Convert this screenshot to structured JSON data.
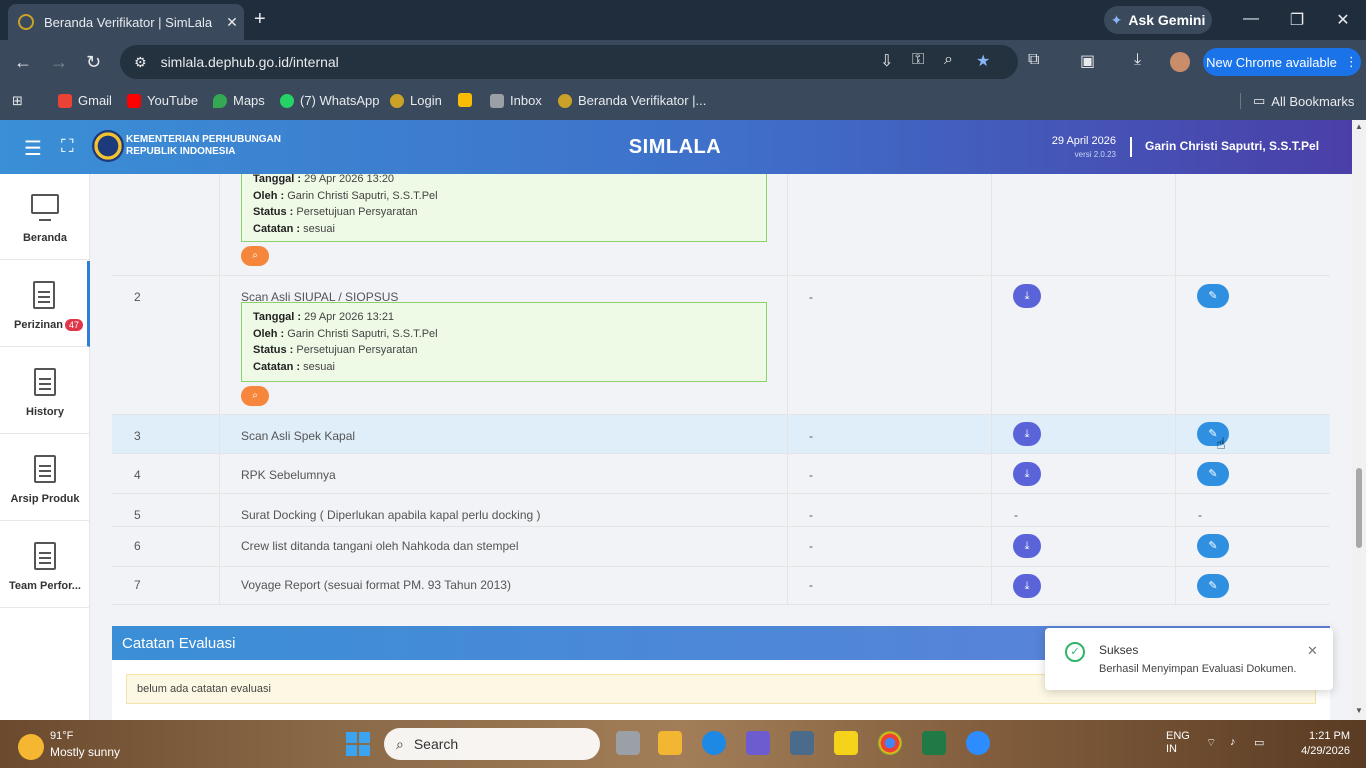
{
  "browser": {
    "tab_title": "Beranda Verifikator | SimLala",
    "new_tab": "+",
    "gemini": "Ask Gemini",
    "url": "simlala.dephub.go.id/internal",
    "new_chrome": "New Chrome available",
    "bookmarks": [
      {
        "label": "Gmail",
        "color": "#ea4335"
      },
      {
        "label": "YouTube",
        "color": "#ff0000"
      },
      {
        "label": "Maps",
        "color": "#34a853"
      },
      {
        "label": "(7) WhatsApp",
        "color": "#25d366"
      },
      {
        "label": "Login",
        "color": "#c9a227"
      },
      {
        "label": "",
        "color": "#fbbc05"
      },
      {
        "label": "Inbox",
        "color": "#9aa0a6"
      },
      {
        "label": "Beranda Verifikator |...",
        "color": "#c9a227"
      }
    ],
    "all_bookmarks": "All Bookmarks"
  },
  "header": {
    "ministry_line1": "KEMENTERIAN PERHUBUNGAN",
    "ministry_line2": "REPUBLIK INDONESIA",
    "app_name": "SIMLALA",
    "date": "29 April 2026",
    "version": "versi 2.0.23",
    "user": "Garin Christi Saputri, S.S.T.Pel"
  },
  "sidebar": {
    "items": [
      {
        "label": "Beranda",
        "icon": "monitor-icon"
      },
      {
        "label": "Perizinan",
        "icon": "document-icon",
        "badge": "47"
      },
      {
        "label": "History",
        "icon": "document-icon"
      },
      {
        "label": "Arsip Produk",
        "icon": "document-icon"
      },
      {
        "label": "Team Perfor...",
        "icon": "document-icon"
      }
    ]
  },
  "table": {
    "top_info": {
      "tanggal": "29 Apr 2026 13:20",
      "oleh": "Garin Christi Saputri, S.S.T.Pel",
      "status": "Persetujuan Persyaratan",
      "catatan": "sesuai"
    },
    "labels": {
      "tanggal": "Tanggal :",
      "oleh": "Oleh :",
      "status": "Status :",
      "catatan": "Catatan :"
    },
    "rows": [
      {
        "no": "2",
        "doc": "Scan Asli SIUPAL / SIOPSUS",
        "ket": "-",
        "info": {
          "tanggal": "29 Apr 2026 13:21",
          "oleh": "Garin Christi Saputri, S.S.T.Pel",
          "status": "Persetujuan Persyaratan",
          "catatan": "sesuai"
        }
      },
      {
        "no": "3",
        "doc": "Scan Asli Spek Kapal",
        "ket": "-"
      },
      {
        "no": "4",
        "doc": "RPK Sebelumnya",
        "ket": "-"
      },
      {
        "no": "5",
        "doc": "Surat Docking ( Diperlukan apabila kapal perlu docking )",
        "ket": "-",
        "dl": "-",
        "ed": "-"
      },
      {
        "no": "6",
        "doc": "Crew list ditanda tangani oleh Nahkoda dan stempel",
        "ket": "-"
      },
      {
        "no": "7",
        "doc": "Voyage Report (sesuai format PM. 93 Tahun 2013)",
        "ket": "-"
      }
    ]
  },
  "evaluation": {
    "title": "Catatan Evaluasi",
    "note": "belum ada catatan evaluasi"
  },
  "toast": {
    "title": "Sukses",
    "message": "Berhasil Menyimpan Evaluasi Dokumen."
  },
  "taskbar": {
    "temp": "91°F",
    "weather": "Mostly sunny",
    "search": "Search",
    "lang1": "ENG",
    "lang2": "IN",
    "time": "1:21 PM",
    "date": "4/29/2026"
  }
}
